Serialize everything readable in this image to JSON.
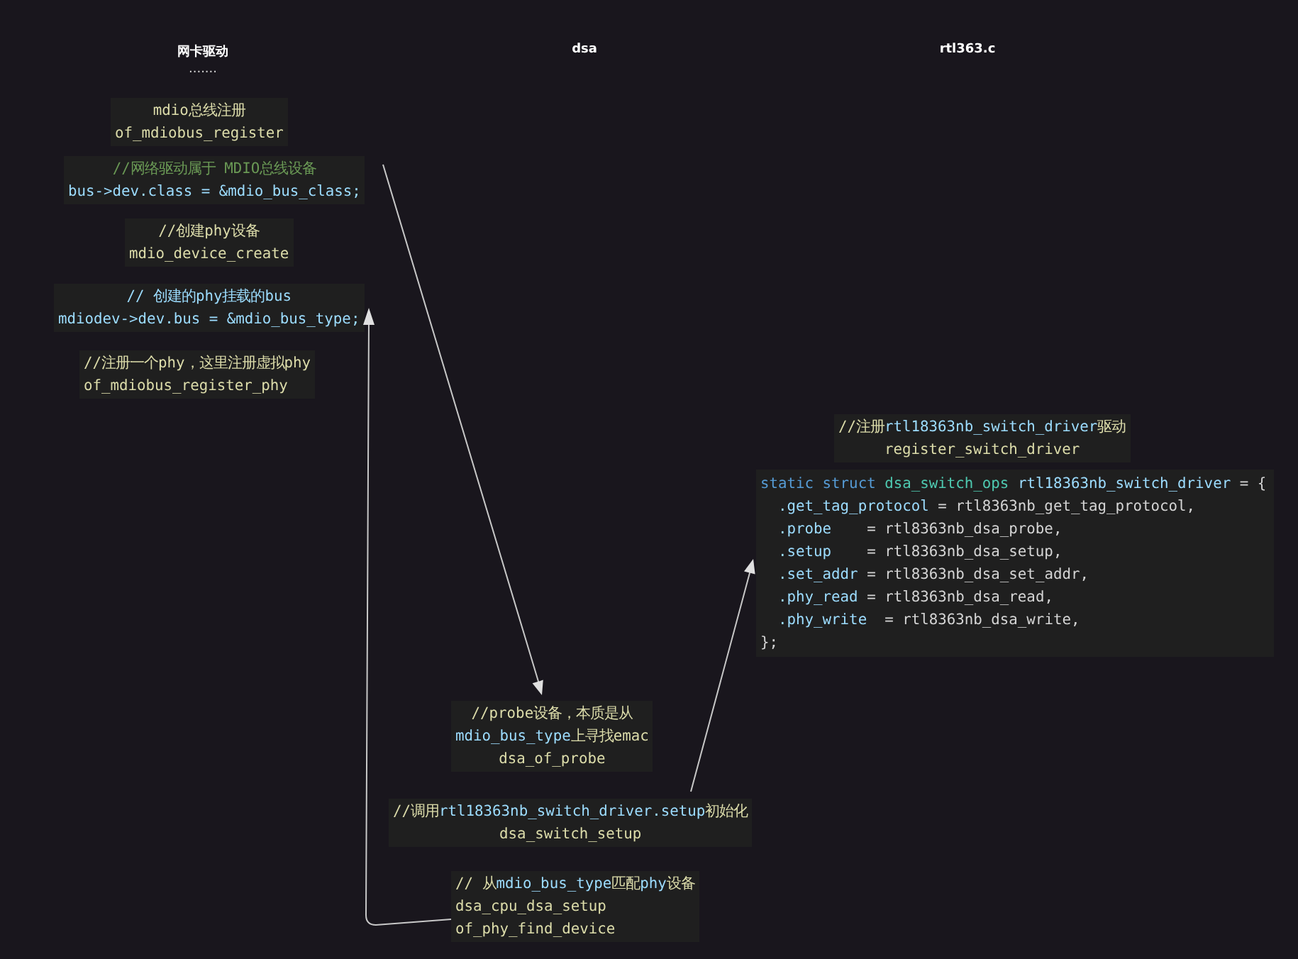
{
  "column_titles": [
    "网卡驱动",
    "dsa",
    "rtl363.c"
  ],
  "ellipsis": ".......",
  "code_blocks": [
    {
      "lines": [
        [
          {
            "kind": "func",
            "text": "mdio总线注册"
          }
        ],
        [
          {
            "kind": "func",
            "text": "of_mdiobus_register"
          }
        ]
      ]
    },
    {
      "lines": [
        [
          {
            "kind": "comment",
            "text": "//网络驱动属于 MDIO总线设备"
          }
        ],
        [
          {
            "kind": "var",
            "text": "bus->dev.class = &mdio_bus_class;"
          }
        ]
      ]
    },
    {
      "lines": [
        [
          {
            "kind": "func",
            "text": "//创建phy设备"
          }
        ],
        [
          {
            "kind": "func",
            "text": "mdio_device_create"
          }
        ]
      ]
    },
    {
      "lines": [
        [
          {
            "kind": "var",
            "text": "// 创建的phy挂载的bus"
          }
        ],
        [
          {
            "kind": "var",
            "text": "mdiodev->dev.bus = &mdio_bus_type;"
          }
        ]
      ]
    },
    {
      "lines": [
        [
          {
            "kind": "func",
            "text": "//注册一个phy，这里注册虚拟phy"
          }
        ],
        [
          {
            "kind": "func",
            "text": "of_mdiobus_register_phy"
          }
        ]
      ]
    },
    {
      "lines": [
        [
          {
            "kind": "func",
            "text": "//注册"
          },
          {
            "kind": "var",
            "text": "rtl18363nb_switch_driver"
          },
          {
            "kind": "func",
            "text": "驱动"
          }
        ],
        [
          {
            "kind": "func",
            "text": "register_switch_driver"
          }
        ]
      ]
    },
    {
      "lines": [
        [
          {
            "kind": "keyword",
            "text": "static struct "
          },
          {
            "kind": "type",
            "text": "dsa_switch_ops "
          },
          {
            "kind": "var",
            "text": "rtl18363nb_switch_driver"
          },
          {
            "kind": "plain",
            "text": " = {"
          }
        ],
        [
          {
            "kind": "var",
            "text": "  .get_tag_protocol"
          },
          {
            "kind": "plain",
            "text": " = rtl8363nb_get_tag_protocol,"
          }
        ],
        [
          {
            "kind": "var",
            "text": "  .probe"
          },
          {
            "kind": "plain",
            "text": "    = rtl8363nb_dsa_probe,"
          }
        ],
        [
          {
            "kind": "var",
            "text": "  .setup"
          },
          {
            "kind": "plain",
            "text": "    = rtl8363nb_dsa_setup,"
          }
        ],
        [
          {
            "kind": "var",
            "text": "  .set_addr"
          },
          {
            "kind": "plain",
            "text": " = rtl8363nb_dsa_set_addr,"
          }
        ],
        [
          {
            "kind": "var",
            "text": "  .phy_read"
          },
          {
            "kind": "plain",
            "text": " = rtl8363nb_dsa_read,"
          }
        ],
        [
          {
            "kind": "var",
            "text": "  .phy_write"
          },
          {
            "kind": "plain",
            "text": "  = rtl8363nb_dsa_write,"
          }
        ],
        [
          {
            "kind": "plain",
            "text": "};"
          }
        ]
      ]
    },
    {
      "lines": [
        [
          {
            "kind": "func",
            "text": "//probe设备，本质是从"
          }
        ],
        [
          {
            "kind": "var",
            "text": "mdio_bus_type"
          },
          {
            "kind": "func",
            "text": "上寻找emac"
          }
        ],
        [
          {
            "kind": "func",
            "text": "dsa_of_probe"
          }
        ]
      ]
    },
    {
      "lines": [
        [
          {
            "kind": "func",
            "text": "//调用"
          },
          {
            "kind": "var",
            "text": "rtl18363nb_switch_driver.setup"
          },
          {
            "kind": "func",
            "text": "初始化"
          }
        ],
        [
          {
            "kind": "func",
            "text": "dsa_switch_setup"
          }
        ]
      ]
    },
    {
      "lines": [
        [
          {
            "kind": "func",
            "text": "// 从"
          },
          {
            "kind": "var",
            "text": "mdio_bus_type"
          },
          {
            "kind": "func",
            "text": "匹配"
          },
          {
            "kind": "var",
            "text": "phy"
          },
          {
            "kind": "func",
            "text": "设备"
          }
        ],
        [
          {
            "kind": "func",
            "text": "dsa_cpu_dsa_setup"
          }
        ],
        [
          {
            "kind": "func",
            "text": "of_phy_find_device"
          }
        ]
      ]
    }
  ]
}
